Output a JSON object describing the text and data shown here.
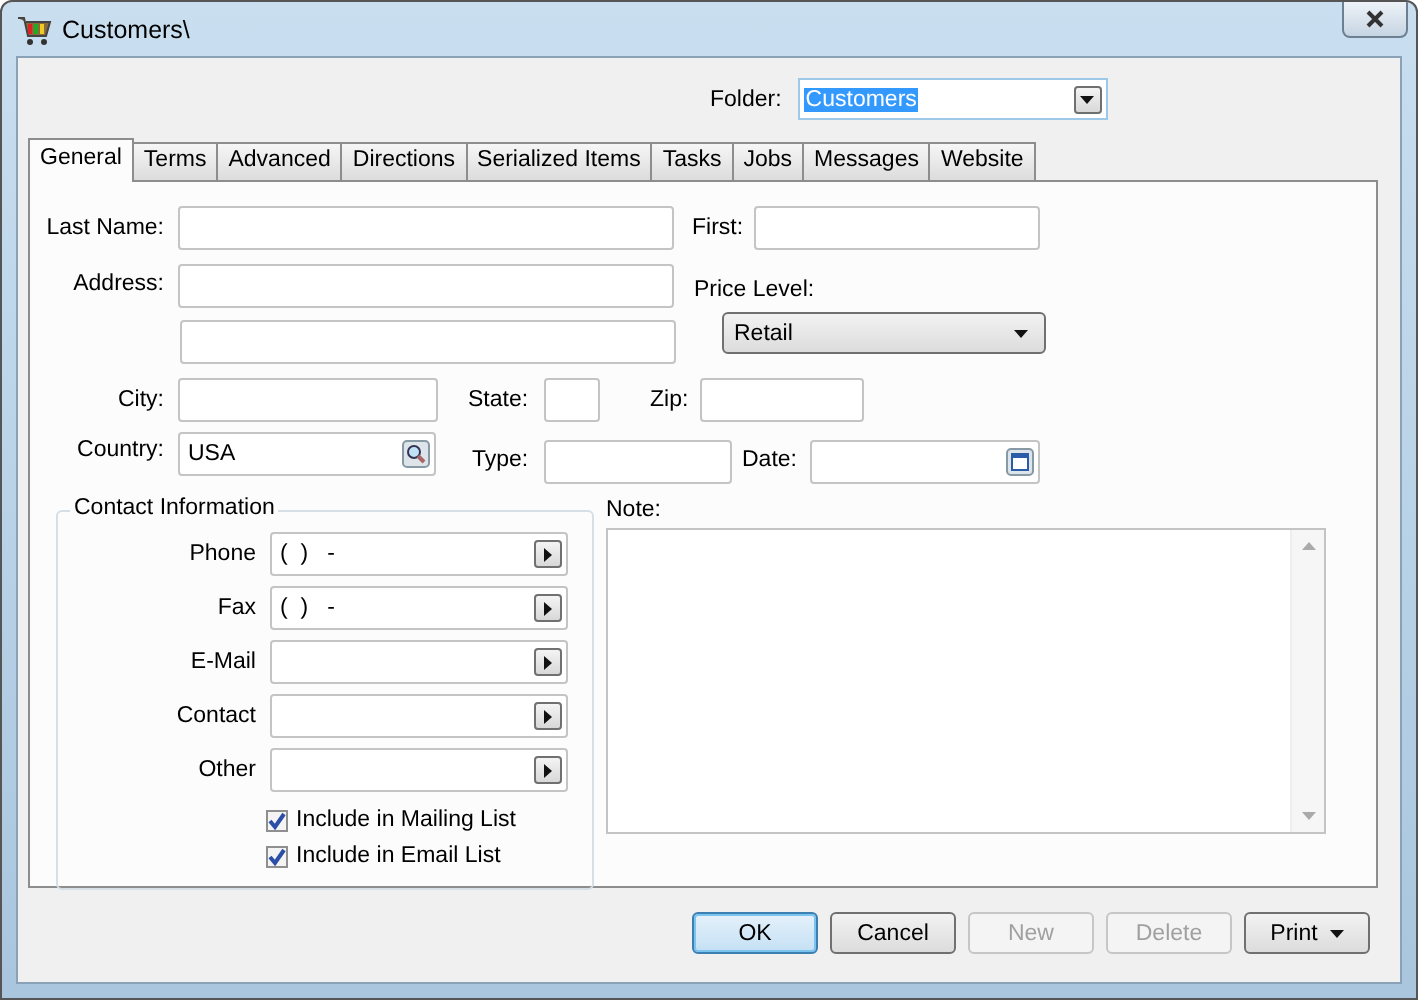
{
  "window": {
    "title": "Customers\\"
  },
  "folder": {
    "label": "Folder:",
    "value": "Customers"
  },
  "tabs": [
    {
      "label": "General",
      "selected": true
    },
    {
      "label": "Terms",
      "selected": false
    },
    {
      "label": "Advanced",
      "selected": false
    },
    {
      "label": "Directions",
      "selected": false
    },
    {
      "label": "Serialized Items",
      "selected": false
    },
    {
      "label": "Tasks",
      "selected": false
    },
    {
      "label": "Jobs",
      "selected": false
    },
    {
      "label": "Messages",
      "selected": false
    },
    {
      "label": "Website",
      "selected": false
    }
  ],
  "general": {
    "last_name": {
      "label": "Last Name:"
    },
    "first": {
      "label": "First:"
    },
    "address": {
      "label": "Address:"
    },
    "price_level": {
      "label": "Price Level:",
      "value": "Retail"
    },
    "city": {
      "label": "City:"
    },
    "state": {
      "label": "State:"
    },
    "zip": {
      "label": "Zip:"
    },
    "country": {
      "label": "Country:",
      "value": "USA"
    },
    "type": {
      "label": "Type:"
    },
    "date": {
      "label": "Date:"
    },
    "contact": {
      "title": "Contact Information",
      "rows": [
        {
          "label": "Phone",
          "value": "(  )   -"
        },
        {
          "label": "Fax",
          "value": "(  )   -"
        },
        {
          "label": "E-Mail"
        },
        {
          "label": "Contact"
        },
        {
          "label": "Other"
        }
      ],
      "checkboxes": [
        {
          "label": "Include in Mailing List",
          "checked": true
        },
        {
          "label": "Include in Email List",
          "checked": true
        }
      ]
    },
    "note": {
      "label": "Note:"
    }
  },
  "buttons": [
    {
      "label": "OK",
      "kind": "push",
      "default": true,
      "disabled": false
    },
    {
      "label": "Cancel",
      "kind": "push",
      "default": false,
      "disabled": false
    },
    {
      "label": "New",
      "kind": "push",
      "default": false,
      "disabled": true
    },
    {
      "label": "Delete",
      "kind": "push",
      "default": false,
      "disabled": true
    },
    {
      "label": "Print",
      "kind": "menu",
      "default": false,
      "disabled": false
    }
  ]
}
